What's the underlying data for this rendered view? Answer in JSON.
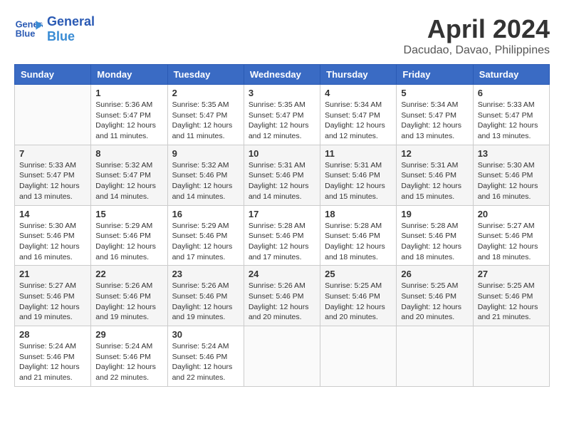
{
  "header": {
    "logo_line1": "General",
    "logo_line2": "Blue",
    "title": "April 2024",
    "subtitle": "Dacudao, Davao, Philippines"
  },
  "days_of_week": [
    "Sunday",
    "Monday",
    "Tuesday",
    "Wednesday",
    "Thursday",
    "Friday",
    "Saturday"
  ],
  "weeks": [
    {
      "days": [
        {
          "number": "",
          "info": ""
        },
        {
          "number": "1",
          "info": "Sunrise: 5:36 AM\nSunset: 5:47 PM\nDaylight: 12 hours\nand 11 minutes."
        },
        {
          "number": "2",
          "info": "Sunrise: 5:35 AM\nSunset: 5:47 PM\nDaylight: 12 hours\nand 11 minutes."
        },
        {
          "number": "3",
          "info": "Sunrise: 5:35 AM\nSunset: 5:47 PM\nDaylight: 12 hours\nand 12 minutes."
        },
        {
          "number": "4",
          "info": "Sunrise: 5:34 AM\nSunset: 5:47 PM\nDaylight: 12 hours\nand 12 minutes."
        },
        {
          "number": "5",
          "info": "Sunrise: 5:34 AM\nSunset: 5:47 PM\nDaylight: 12 hours\nand 13 minutes."
        },
        {
          "number": "6",
          "info": "Sunrise: 5:33 AM\nSunset: 5:47 PM\nDaylight: 12 hours\nand 13 minutes."
        }
      ]
    },
    {
      "days": [
        {
          "number": "7",
          "info": "Sunrise: 5:33 AM\nSunset: 5:47 PM\nDaylight: 12 hours\nand 13 minutes."
        },
        {
          "number": "8",
          "info": "Sunrise: 5:32 AM\nSunset: 5:47 PM\nDaylight: 12 hours\nand 14 minutes."
        },
        {
          "number": "9",
          "info": "Sunrise: 5:32 AM\nSunset: 5:46 PM\nDaylight: 12 hours\nand 14 minutes."
        },
        {
          "number": "10",
          "info": "Sunrise: 5:31 AM\nSunset: 5:46 PM\nDaylight: 12 hours\nand 14 minutes."
        },
        {
          "number": "11",
          "info": "Sunrise: 5:31 AM\nSunset: 5:46 PM\nDaylight: 12 hours\nand 15 minutes."
        },
        {
          "number": "12",
          "info": "Sunrise: 5:31 AM\nSunset: 5:46 PM\nDaylight: 12 hours\nand 15 minutes."
        },
        {
          "number": "13",
          "info": "Sunrise: 5:30 AM\nSunset: 5:46 PM\nDaylight: 12 hours\nand 16 minutes."
        }
      ]
    },
    {
      "days": [
        {
          "number": "14",
          "info": "Sunrise: 5:30 AM\nSunset: 5:46 PM\nDaylight: 12 hours\nand 16 minutes."
        },
        {
          "number": "15",
          "info": "Sunrise: 5:29 AM\nSunset: 5:46 PM\nDaylight: 12 hours\nand 16 minutes."
        },
        {
          "number": "16",
          "info": "Sunrise: 5:29 AM\nSunset: 5:46 PM\nDaylight: 12 hours\nand 17 minutes."
        },
        {
          "number": "17",
          "info": "Sunrise: 5:28 AM\nSunset: 5:46 PM\nDaylight: 12 hours\nand 17 minutes."
        },
        {
          "number": "18",
          "info": "Sunrise: 5:28 AM\nSunset: 5:46 PM\nDaylight: 12 hours\nand 18 minutes."
        },
        {
          "number": "19",
          "info": "Sunrise: 5:28 AM\nSunset: 5:46 PM\nDaylight: 12 hours\nand 18 minutes."
        },
        {
          "number": "20",
          "info": "Sunrise: 5:27 AM\nSunset: 5:46 PM\nDaylight: 12 hours\nand 18 minutes."
        }
      ]
    },
    {
      "days": [
        {
          "number": "21",
          "info": "Sunrise: 5:27 AM\nSunset: 5:46 PM\nDaylight: 12 hours\nand 19 minutes."
        },
        {
          "number": "22",
          "info": "Sunrise: 5:26 AM\nSunset: 5:46 PM\nDaylight: 12 hours\nand 19 minutes."
        },
        {
          "number": "23",
          "info": "Sunrise: 5:26 AM\nSunset: 5:46 PM\nDaylight: 12 hours\nand 19 minutes."
        },
        {
          "number": "24",
          "info": "Sunrise: 5:26 AM\nSunset: 5:46 PM\nDaylight: 12 hours\nand 20 minutes."
        },
        {
          "number": "25",
          "info": "Sunrise: 5:25 AM\nSunset: 5:46 PM\nDaylight: 12 hours\nand 20 minutes."
        },
        {
          "number": "26",
          "info": "Sunrise: 5:25 AM\nSunset: 5:46 PM\nDaylight: 12 hours\nand 20 minutes."
        },
        {
          "number": "27",
          "info": "Sunrise: 5:25 AM\nSunset: 5:46 PM\nDaylight: 12 hours\nand 21 minutes."
        }
      ]
    },
    {
      "days": [
        {
          "number": "28",
          "info": "Sunrise: 5:24 AM\nSunset: 5:46 PM\nDaylight: 12 hours\nand 21 minutes."
        },
        {
          "number": "29",
          "info": "Sunrise: 5:24 AM\nSunset: 5:46 PM\nDaylight: 12 hours\nand 22 minutes."
        },
        {
          "number": "30",
          "info": "Sunrise: 5:24 AM\nSunset: 5:46 PM\nDaylight: 12 hours\nand 22 minutes."
        },
        {
          "number": "",
          "info": ""
        },
        {
          "number": "",
          "info": ""
        },
        {
          "number": "",
          "info": ""
        },
        {
          "number": "",
          "info": ""
        }
      ]
    }
  ]
}
